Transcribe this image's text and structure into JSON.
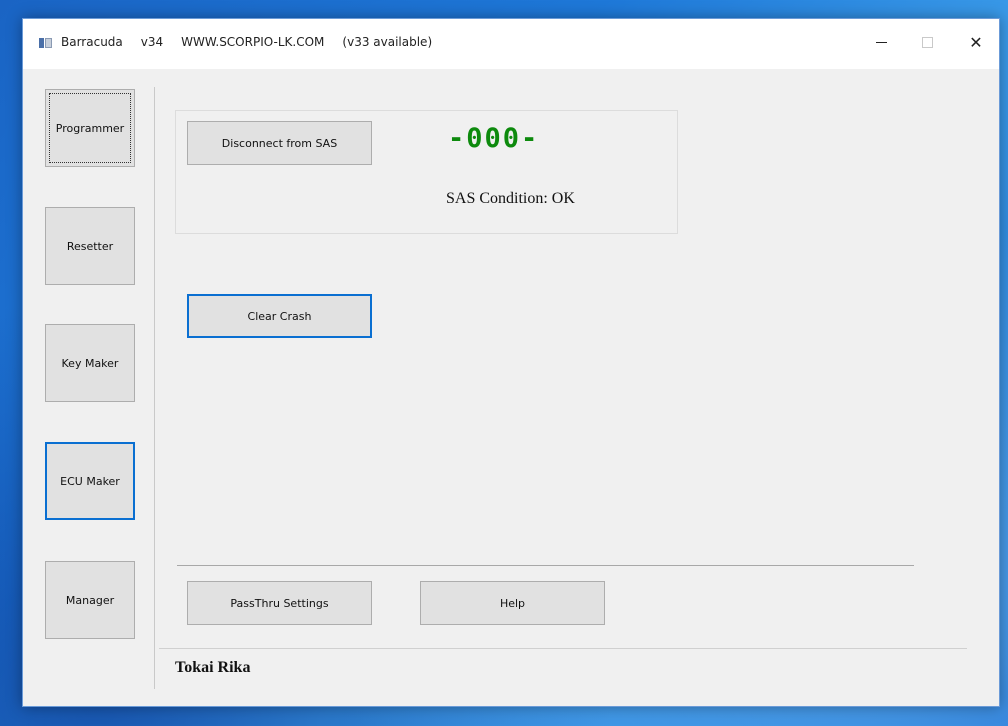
{
  "window": {
    "app_name": "Barracuda",
    "version": "v34",
    "website": "WWW.SCORPIO-LK.COM",
    "update_notice": "(v33 available)",
    "close_glyph": "✕"
  },
  "sidebar": {
    "items": [
      {
        "label": "Programmer",
        "state": "focused"
      },
      {
        "label": "Resetter",
        "state": "normal"
      },
      {
        "label": "Key Maker",
        "state": "normal"
      },
      {
        "label": "ECU Maker",
        "state": "active"
      },
      {
        "label": "Manager",
        "state": "normal"
      }
    ]
  },
  "sas_panel": {
    "disconnect_label": "Disconnect from SAS",
    "status_code": "-000-",
    "status_code_color": "#0d8a0d",
    "condition_text": "SAS Condition: OK"
  },
  "actions": {
    "clear_crash_label": "Clear Crash"
  },
  "footer": {
    "passthru_label": "PassThru Settings",
    "help_label": "Help",
    "module_label": "Tokai Rika"
  },
  "colors": {
    "focus_accent": "#0a6fd1",
    "window_bg": "#f0f0f0"
  }
}
